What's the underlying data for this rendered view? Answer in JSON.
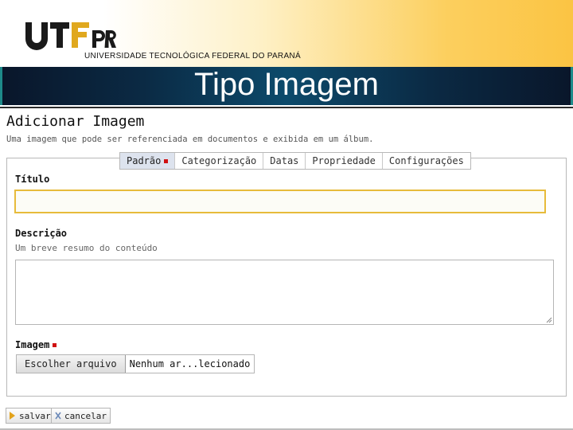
{
  "header": {
    "logo_text": "UTFPR",
    "university_name": "UNIVERSIDADE TECNOLÓGICA FEDERAL DO PARANÁ",
    "slide_title": "Tipo Imagem"
  },
  "form": {
    "heading": "Adicionar Imagem",
    "description": "Uma imagem que pode ser referenciada em documentos e exibida em um álbum.",
    "tabs": [
      {
        "label": "Padrão",
        "active": true,
        "required": true
      },
      {
        "label": "Categorização"
      },
      {
        "label": "Datas"
      },
      {
        "label": "Propriedade"
      },
      {
        "label": "Configurações"
      }
    ],
    "fields": {
      "title_label": "Título",
      "title_value": "",
      "description_label": "Descrição",
      "description_help": "Um breve resumo do conteúdo",
      "description_value": "",
      "image_label": "Imagem",
      "file_button": "Escolher arquivo",
      "file_status": "Nenhum ar...lecionado"
    },
    "actions": {
      "save_label": "salvar",
      "cancel_label": "cancelar"
    }
  },
  "colors": {
    "required_marker": "#d01010",
    "focused_input_border": "#e7bb3b",
    "banner_accent": "#fbc443",
    "title_bar": "#0c4a6b"
  }
}
